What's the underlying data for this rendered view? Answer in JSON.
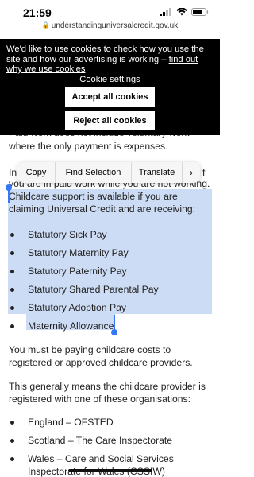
{
  "status_bar": {
    "time": "21:59"
  },
  "url_bar": {
    "domain": "understandinguniversalcredit.gov.uk"
  },
  "cookie_banner": {
    "text": "We'd like to use cookies to check how you use the site and how our advertising is working – ",
    "link": "find out why we use cookies",
    "settings_link": "Cookie settings",
    "accept_label": "Accept all cookies",
    "reject_label": "Reject all cookies"
  },
  "article": {
    "para_hidden_1": "Paid work does not include voluntary work",
    "para_hidden_2": "where the only payment is expenses.",
    "para_partial_left": "In",
    "para_partial_right": "f",
    "para_working": "you are in paid work while you are not working.",
    "selected_intro": "Childcare support is available if you are claiming Universal Credit and are receiving:",
    "benefits": [
      "Statutory Sick Pay",
      "Statutory Maternity Pay",
      "Statutory Paternity Pay",
      "Statutory Shared Parental Pay",
      "Statutory Adoption Pay",
      "Maternity Allowance"
    ],
    "para_costs": "You must be paying childcare costs to registered or approved childcare providers.",
    "para_registered": "This generally means the childcare provider is registered with one of these organisations:",
    "organisations": [
      "England – OFSTED",
      "Scotland – The Care Inspectorate",
      "Wales – Care and Social Services Inspectorate for Wales (CSSIW)"
    ]
  },
  "context_menu": {
    "copy": "Copy",
    "find_selection": "Find Selection",
    "translate": "Translate",
    "more": "›"
  }
}
